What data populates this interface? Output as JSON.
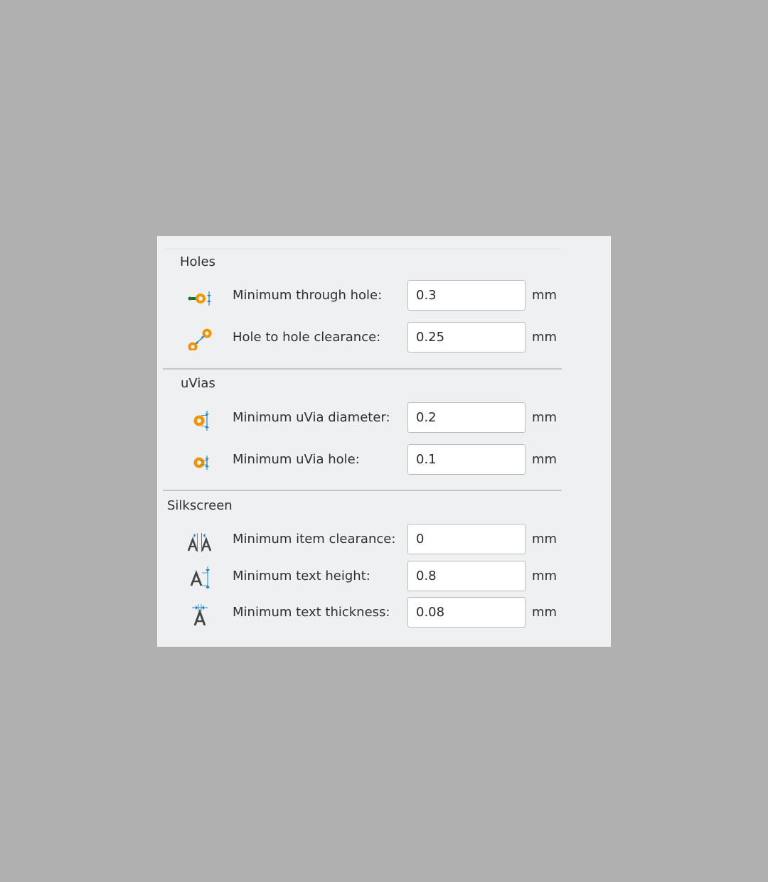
{
  "sections": {
    "holes": {
      "title": "Holes",
      "rows": [
        {
          "label": "Minimum through hole:",
          "value": "0.3",
          "unit": "mm",
          "icon": "through-hole-icon"
        },
        {
          "label": "Hole to hole clearance:",
          "value": "0.25",
          "unit": "mm",
          "icon": "hole-clearance-icon"
        }
      ]
    },
    "uvias": {
      "title": "uVias",
      "rows": [
        {
          "label": "Minimum uVia diameter:",
          "value": "0.2",
          "unit": "mm",
          "icon": "uvia-diameter-icon"
        },
        {
          "label": "Minimum uVia hole:",
          "value": "0.1",
          "unit": "mm",
          "icon": "uvia-hole-icon"
        }
      ]
    },
    "silkscreen": {
      "title": "Silkscreen",
      "rows": [
        {
          "label": "Minimum item clearance:",
          "value": "0",
          "unit": "mm",
          "icon": "item-clearance-icon"
        },
        {
          "label": "Minimum text height:",
          "value": "0.8",
          "unit": "mm",
          "icon": "text-height-icon"
        },
        {
          "label": "Minimum text thickness:",
          "value": "0.08",
          "unit": "mm",
          "icon": "text-thickness-icon"
        }
      ]
    }
  },
  "colors": {
    "pad_orange": "#f29400",
    "pad_hole": "#f2f2f2",
    "dimension_blue": "#1f86c9",
    "track_green": "#1a7a2a",
    "letter_gray": "#454545"
  }
}
